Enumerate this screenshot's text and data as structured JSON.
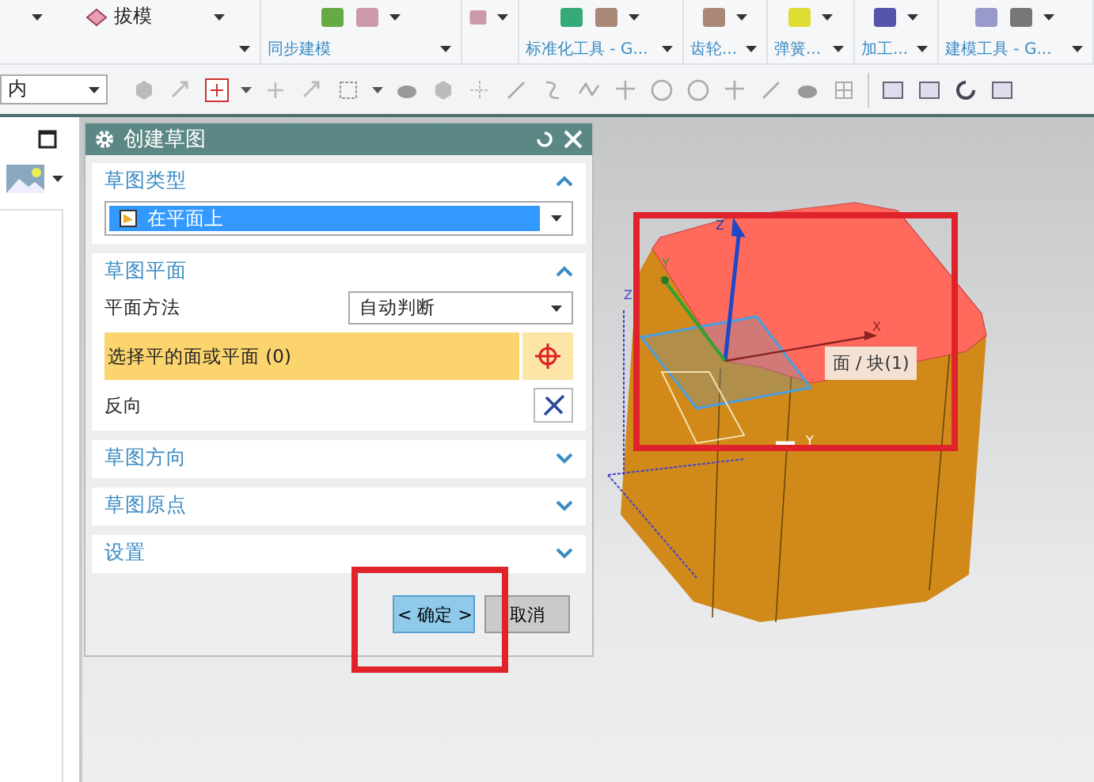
{
  "ribbon": {
    "draft_button": "拔模",
    "group_labels": [
      "同步建模",
      "标准化工具 - G...",
      "齿轮...",
      "弹簧...",
      "加工...",
      "建模工具 - G..."
    ]
  },
  "toolbar": {
    "filter_value": "内"
  },
  "dialog": {
    "title": "创建草图",
    "sections": [
      {
        "kind": "type",
        "title": "草图类型",
        "expanded": true,
        "type_value": "在平面上"
      },
      {
        "kind": "plane",
        "title": "草图平面",
        "expanded": true,
        "method_label": "平面方法",
        "method_value": "自动判断",
        "select_label": "选择平的面或平面 (0)",
        "selection_active": true,
        "reverse_label": "反向"
      },
      {
        "title": "草图方向",
        "expanded": false
      },
      {
        "title": "草图原点",
        "expanded": false
      },
      {
        "title": "设置",
        "expanded": false
      }
    ],
    "buttons": [
      {
        "label": "< 确定 >",
        "kind": "default"
      },
      {
        "label": "取消",
        "kind": "normal"
      }
    ]
  },
  "viewport": {
    "tooltip": "面 / 块(1)",
    "axis_labels": [
      "Z",
      "Y",
      "X",
      "Y",
      "Z"
    ]
  }
}
